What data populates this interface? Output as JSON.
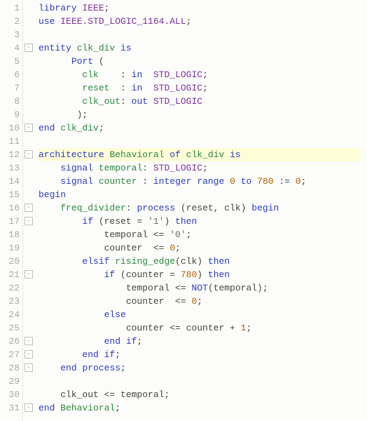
{
  "lines": [
    {
      "n": 1,
      "fold": "",
      "hl": false,
      "tokens": [
        [
          "kw",
          "library"
        ],
        [
          "plain",
          " "
        ],
        [
          "type",
          "IEEE"
        ],
        [
          "plain",
          ";"
        ]
      ]
    },
    {
      "n": 2,
      "fold": "",
      "hl": false,
      "tokens": [
        [
          "kw",
          "use"
        ],
        [
          "plain",
          " "
        ],
        [
          "type",
          "IEEE.STD_LOGIC_1164.ALL"
        ],
        [
          "plain",
          ";"
        ]
      ]
    },
    {
      "n": 3,
      "fold": "",
      "hl": false,
      "tokens": [
        [
          "plain",
          ""
        ]
      ]
    },
    {
      "n": 4,
      "fold": "-",
      "hl": false,
      "tokens": [
        [
          "kw",
          "entity"
        ],
        [
          "plain",
          " "
        ],
        [
          "ident",
          "clk_div"
        ],
        [
          "plain",
          " "
        ],
        [
          "kw",
          "is"
        ]
      ]
    },
    {
      "n": 5,
      "fold": "",
      "hl": false,
      "tokens": [
        [
          "plain",
          "      "
        ],
        [
          "kw",
          "Port"
        ],
        [
          "plain",
          " ("
        ]
      ]
    },
    {
      "n": 6,
      "fold": "",
      "hl": false,
      "tokens": [
        [
          "plain",
          "        "
        ],
        [
          "ident",
          "clk"
        ],
        [
          "plain",
          "    : "
        ],
        [
          "kw",
          "in"
        ],
        [
          "plain",
          "  "
        ],
        [
          "type",
          "STD_LOGIC"
        ],
        [
          "plain",
          ";"
        ]
      ]
    },
    {
      "n": 7,
      "fold": "",
      "hl": false,
      "tokens": [
        [
          "plain",
          "        "
        ],
        [
          "ident",
          "reset"
        ],
        [
          "plain",
          "  : "
        ],
        [
          "kw",
          "in"
        ],
        [
          "plain",
          "  "
        ],
        [
          "type",
          "STD_LOGIC"
        ],
        [
          "plain",
          ";"
        ]
      ]
    },
    {
      "n": 8,
      "fold": "",
      "hl": false,
      "tokens": [
        [
          "plain",
          "        "
        ],
        [
          "ident",
          "clk_out"
        ],
        [
          "plain",
          ": "
        ],
        [
          "kw",
          "out"
        ],
        [
          "plain",
          " "
        ],
        [
          "type",
          "STD_LOGIC"
        ]
      ]
    },
    {
      "n": 9,
      "fold": "",
      "hl": false,
      "tokens": [
        [
          "plain",
          "       );"
        ]
      ]
    },
    {
      "n": 10,
      "fold": "-",
      "hl": false,
      "tokens": [
        [
          "kw",
          "end"
        ],
        [
          "plain",
          " "
        ],
        [
          "ident",
          "clk_div"
        ],
        [
          "plain",
          ";"
        ]
      ]
    },
    {
      "n": 11,
      "fold": "",
      "hl": false,
      "tokens": [
        [
          "plain",
          ""
        ]
      ]
    },
    {
      "n": 12,
      "fold": "-",
      "hl": true,
      "tokens": [
        [
          "kw",
          "architecture"
        ],
        [
          "plain",
          " "
        ],
        [
          "ident",
          "Behavioral"
        ],
        [
          "plain",
          " "
        ],
        [
          "kw",
          "of"
        ],
        [
          "plain",
          " "
        ],
        [
          "ident",
          "clk_div"
        ],
        [
          "plain",
          " "
        ],
        [
          "kw",
          "is"
        ]
      ]
    },
    {
      "n": 13,
      "fold": "",
      "hl": false,
      "tokens": [
        [
          "plain",
          "    "
        ],
        [
          "kw",
          "signal"
        ],
        [
          "plain",
          " "
        ],
        [
          "ident",
          "temporal"
        ],
        [
          "plain",
          ": "
        ],
        [
          "type",
          "STD_LOGIC"
        ],
        [
          "plain",
          ";"
        ]
      ]
    },
    {
      "n": 14,
      "fold": "",
      "hl": false,
      "tokens": [
        [
          "plain",
          "    "
        ],
        [
          "kw",
          "signal"
        ],
        [
          "plain",
          " "
        ],
        [
          "ident",
          "counter"
        ],
        [
          "plain",
          " : "
        ],
        [
          "kw",
          "integer"
        ],
        [
          "plain",
          " "
        ],
        [
          "kw",
          "range"
        ],
        [
          "plain",
          " "
        ],
        [
          "num",
          "0"
        ],
        [
          "plain",
          " "
        ],
        [
          "kw",
          "to"
        ],
        [
          "plain",
          " "
        ],
        [
          "num",
          "780"
        ],
        [
          "plain",
          " := "
        ],
        [
          "num",
          "0"
        ],
        [
          "plain",
          ";"
        ]
      ]
    },
    {
      "n": 15,
      "fold": "",
      "hl": false,
      "tokens": [
        [
          "kw",
          "begin"
        ]
      ]
    },
    {
      "n": 16,
      "fold": "-",
      "hl": false,
      "tokens": [
        [
          "plain",
          "    "
        ],
        [
          "ident",
          "freq_divider"
        ],
        [
          "plain",
          ": "
        ],
        [
          "kw",
          "process"
        ],
        [
          "plain",
          " (reset, clk) "
        ],
        [
          "kw",
          "begin"
        ]
      ]
    },
    {
      "n": 17,
      "fold": "-",
      "hl": false,
      "tokens": [
        [
          "plain",
          "        "
        ],
        [
          "kw",
          "if"
        ],
        [
          "plain",
          " (reset = "
        ],
        [
          "str",
          "'1'"
        ],
        [
          "plain",
          ") "
        ],
        [
          "kw",
          "then"
        ]
      ]
    },
    {
      "n": 18,
      "fold": "",
      "hl": false,
      "tokens": [
        [
          "plain",
          "            temporal <= "
        ],
        [
          "str",
          "'0'"
        ],
        [
          "plain",
          ";"
        ]
      ]
    },
    {
      "n": 19,
      "fold": "",
      "hl": false,
      "tokens": [
        [
          "plain",
          "            counter  <= "
        ],
        [
          "num",
          "0"
        ],
        [
          "plain",
          ";"
        ]
      ]
    },
    {
      "n": 20,
      "fold": "",
      "hl": false,
      "tokens": [
        [
          "plain",
          "        "
        ],
        [
          "kw",
          "elsif"
        ],
        [
          "plain",
          " "
        ],
        [
          "ident",
          "rising_edge"
        ],
        [
          "plain",
          "(clk) "
        ],
        [
          "kw",
          "then"
        ]
      ]
    },
    {
      "n": 21,
      "fold": "-",
      "hl": false,
      "tokens": [
        [
          "plain",
          "            "
        ],
        [
          "kw",
          "if"
        ],
        [
          "plain",
          " (counter = "
        ],
        [
          "num",
          "780"
        ],
        [
          "plain",
          ") "
        ],
        [
          "kw",
          "then"
        ]
      ]
    },
    {
      "n": 22,
      "fold": "",
      "hl": false,
      "tokens": [
        [
          "plain",
          "                temporal <= "
        ],
        [
          "kw",
          "NOT"
        ],
        [
          "plain",
          "(temporal);"
        ]
      ]
    },
    {
      "n": 23,
      "fold": "",
      "hl": false,
      "tokens": [
        [
          "plain",
          "                counter  <= "
        ],
        [
          "num",
          "0"
        ],
        [
          "plain",
          ";"
        ]
      ]
    },
    {
      "n": 24,
      "fold": "",
      "hl": false,
      "tokens": [
        [
          "plain",
          "            "
        ],
        [
          "kw",
          "else"
        ]
      ]
    },
    {
      "n": 25,
      "fold": "",
      "hl": false,
      "tokens": [
        [
          "plain",
          "                counter <= counter + "
        ],
        [
          "num",
          "1"
        ],
        [
          "plain",
          ";"
        ]
      ]
    },
    {
      "n": 26,
      "fold": "-",
      "hl": false,
      "tokens": [
        [
          "plain",
          "            "
        ],
        [
          "kw",
          "end"
        ],
        [
          "plain",
          " "
        ],
        [
          "kw",
          "if"
        ],
        [
          "plain",
          ";"
        ]
      ]
    },
    {
      "n": 27,
      "fold": "-",
      "hl": false,
      "tokens": [
        [
          "plain",
          "        "
        ],
        [
          "kw",
          "end"
        ],
        [
          "plain",
          " "
        ],
        [
          "kw",
          "if"
        ],
        [
          "plain",
          ";"
        ]
      ]
    },
    {
      "n": 28,
      "fold": "-",
      "hl": false,
      "tokens": [
        [
          "plain",
          "    "
        ],
        [
          "kw",
          "end"
        ],
        [
          "plain",
          " "
        ],
        [
          "kw",
          "process"
        ],
        [
          "plain",
          ";"
        ]
      ]
    },
    {
      "n": 29,
      "fold": "",
      "hl": false,
      "tokens": [
        [
          "plain",
          ""
        ]
      ]
    },
    {
      "n": 30,
      "fold": "",
      "hl": false,
      "tokens": [
        [
          "plain",
          "    clk_out <= temporal;"
        ]
      ]
    },
    {
      "n": 31,
      "fold": "-",
      "hl": false,
      "tokens": [
        [
          "kw",
          "end"
        ],
        [
          "plain",
          " "
        ],
        [
          "ident",
          "Behavioral"
        ],
        [
          "plain",
          ";"
        ]
      ]
    }
  ]
}
